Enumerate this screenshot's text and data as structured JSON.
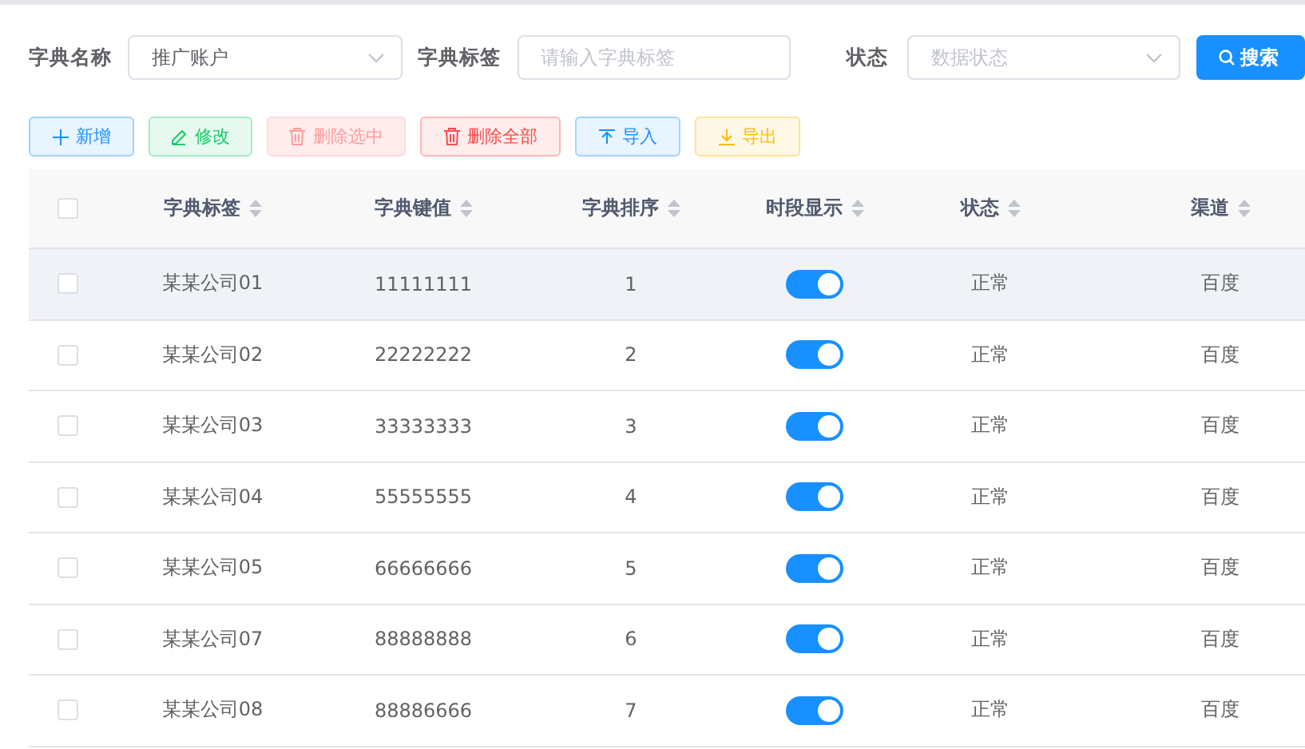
{
  "filters": [
    {
      "kind": "select",
      "label": "字典名称",
      "value": "推广账户"
    },
    {
      "kind": "input",
      "label": "字典标签",
      "placeholder": "请输入字典标签"
    },
    {
      "kind": "select",
      "label": "状态",
      "placeholder": "数据状态"
    }
  ],
  "search_button": {
    "label": "搜索"
  },
  "toolbar": [
    {
      "kind": "add",
      "label": "新增"
    },
    {
      "kind": "edit",
      "label": "修改"
    },
    {
      "kind": "delete-selected",
      "label": "删除选中"
    },
    {
      "kind": "delete-all",
      "label": "删除全部"
    },
    {
      "kind": "import",
      "label": "导入"
    },
    {
      "kind": "export",
      "label": "导出"
    }
  ],
  "table": {
    "select_all_checked": false,
    "columns": [
      "字典标签",
      "字典键值",
      "字典排序",
      "时段显示",
      "状态",
      "渠道"
    ],
    "rows": [
      {
        "checked": false,
        "hovered": true,
        "label": "某某公司01",
        "key": "11111111",
        "order": "1",
        "time_display": true,
        "status": "正常",
        "channel": "百度"
      },
      {
        "checked": false,
        "hovered": false,
        "label": "某某公司02",
        "key": "22222222",
        "order": "2",
        "time_display": true,
        "status": "正常",
        "channel": "百度"
      },
      {
        "checked": false,
        "hovered": false,
        "label": "某某公司03",
        "key": "33333333",
        "order": "3",
        "time_display": true,
        "status": "正常",
        "channel": "百度"
      },
      {
        "checked": false,
        "hovered": false,
        "label": "某某公司04",
        "key": "55555555",
        "order": "4",
        "time_display": true,
        "status": "正常",
        "channel": "百度"
      },
      {
        "checked": false,
        "hovered": false,
        "label": "某某公司05",
        "key": "66666666",
        "order": "5",
        "time_display": true,
        "status": "正常",
        "channel": "百度"
      },
      {
        "checked": false,
        "hovered": false,
        "label": "某某公司07",
        "key": "88888888",
        "order": "6",
        "time_display": true,
        "status": "正常",
        "channel": "百度"
      },
      {
        "checked": false,
        "hovered": false,
        "label": "某某公司08",
        "key": "88886666",
        "order": "7",
        "time_display": true,
        "status": "正常",
        "channel": "百度"
      }
    ]
  }
}
